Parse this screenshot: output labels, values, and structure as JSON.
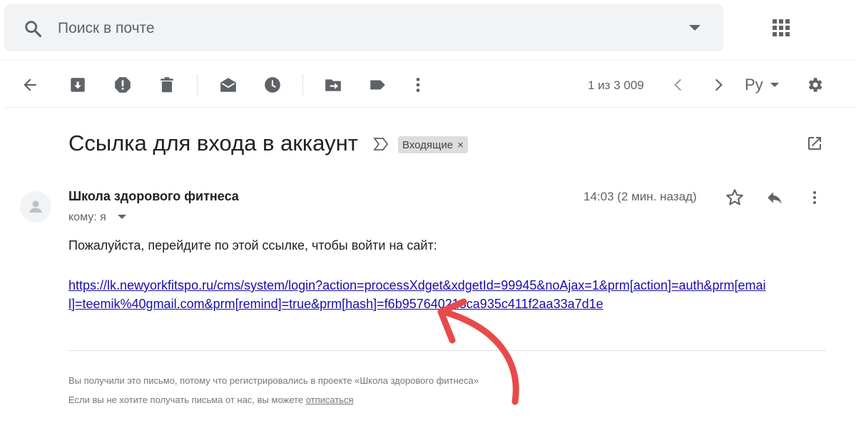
{
  "search": {
    "placeholder": "Поиск в почте"
  },
  "toolbar": {
    "pager": "1 из 3 009",
    "language": "Ру"
  },
  "message": {
    "subject": "Ссылка для входа в аккаунт",
    "label": "Входящие",
    "label_close": "×",
    "sender": "Школа здорового фитнеса",
    "to": "кому: я",
    "time": "14:03 (2 мин. назад)",
    "body_text": "Пожалуйста, перейдите по этой ссылке, чтобы войти на сайт:",
    "link_text": "https://lk.newyorkfitspo.ru/cms/system/login?action=processXdget&xdgetId=99945&noAjax=1&prm[action]=auth&prm[email]=teemik%40gmail.com&prm[remind]=true&prm[hash]=f6b957640213ca935c411f2aa33a7d1e",
    "footer_line1": "Вы получили это письмо, потому что регистрировались в проекте «Школа здорового фитнеса»",
    "footer_line2_prefix": "Если вы не хотите получать письма от нас, вы можете ",
    "footer_unsubscribe": "отписаться"
  },
  "icons": {
    "search": "search-icon",
    "apps": "apps-grid-icon",
    "back": "arrow-back-icon",
    "archive": "archive-icon",
    "spam": "report-spam-icon",
    "delete": "trash-icon",
    "mark_unread": "mark-unread-icon",
    "snooze": "clock-icon",
    "move": "move-to-icon",
    "labels": "label-icon",
    "more": "more-vert-icon",
    "prev": "chevron-left-icon",
    "next": "chevron-right-icon",
    "settings": "gear-icon",
    "important": "important-marker-icon",
    "popout": "open-in-new-icon",
    "star": "star-icon",
    "reply": "reply-icon",
    "annotation_arrow": "red-curved-arrow-annotation"
  },
  "colors": {
    "link": "#1a0dab",
    "annotation_arrow": "#e84a4a",
    "search_bg": "#f1f3f4",
    "icon": "#5f6368"
  }
}
